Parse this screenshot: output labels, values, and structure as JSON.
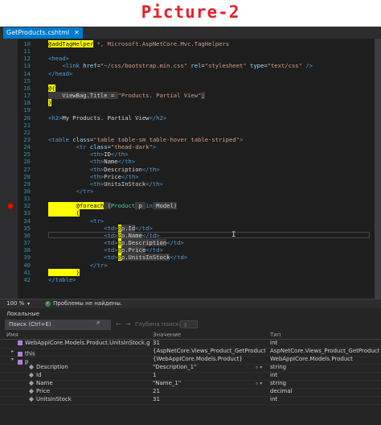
{
  "picture_title": "Picture-2",
  "editor": {
    "tab_label": "GetProducts.cshtml",
    "tab_close": "✕",
    "lines": [
      {
        "n": "10",
        "segments": [
          {
            "t": "@",
            "c": "razor"
          },
          {
            "t": "addTagHelper",
            "c": "razor"
          },
          {
            "t": " *, Microsoft.AspNetCore.Mvc.TagHelpers",
            "c": "str"
          }
        ]
      },
      {
        "n": "11",
        "segments": []
      },
      {
        "n": "12",
        "segments": [
          {
            "t": "<",
            "c": "tag"
          },
          {
            "t": "head",
            "c": "tag"
          },
          {
            "t": ">",
            "c": "tag"
          }
        ]
      },
      {
        "n": "13",
        "segments": [
          {
            "t": "    <",
            "c": "tag"
          },
          {
            "t": "link",
            "c": "tag"
          },
          {
            "t": " href",
            "c": "attr"
          },
          {
            "t": "=",
            "c": "txt"
          },
          {
            "t": "\"~/css/bootstrap.min.css\"",
            "c": "str"
          },
          {
            "t": " rel",
            "c": "attr"
          },
          {
            "t": "=",
            "c": "txt"
          },
          {
            "t": "\"stylesheet\"",
            "c": "str"
          },
          {
            "t": " type",
            "c": "attr"
          },
          {
            "t": "=",
            "c": "txt"
          },
          {
            "t": "\"text/css\"",
            "c": "str"
          },
          {
            "t": " />",
            "c": "tag"
          }
        ]
      },
      {
        "n": "14",
        "segments": [
          {
            "t": "</",
            "c": "tag"
          },
          {
            "t": "head",
            "c": "tag"
          },
          {
            "t": ">",
            "c": "tag"
          }
        ]
      },
      {
        "n": "15",
        "segments": []
      },
      {
        "n": "16",
        "segments": [
          {
            "t": "@{",
            "c": "razor"
          }
        ]
      },
      {
        "n": "17",
        "segments": [
          {
            "t": "    ViewBag.Title = ",
            "c": "rz"
          },
          {
            "t": "\"Products. Partial View\"",
            "c": "str"
          },
          {
            "t": ";",
            "c": "rz"
          }
        ]
      },
      {
        "n": "18",
        "segments": [
          {
            "t": "}",
            "c": "razor"
          }
        ]
      },
      {
        "n": "19",
        "segments": []
      },
      {
        "n": "20",
        "segments": [
          {
            "t": "<",
            "c": "tag"
          },
          {
            "t": "h2",
            "c": "tag"
          },
          {
            "t": ">",
            "c": "tag"
          },
          {
            "t": "My Products. Partial View",
            "c": "txt"
          },
          {
            "t": "</",
            "c": "tag"
          },
          {
            "t": "h2",
            "c": "tag"
          },
          {
            "t": ">",
            "c": "tag"
          }
        ]
      },
      {
        "n": "21",
        "segments": []
      },
      {
        "n": "22",
        "segments": []
      },
      {
        "n": "23",
        "segments": [
          {
            "t": "<",
            "c": "tag"
          },
          {
            "t": "table",
            "c": "tag"
          },
          {
            "t": " class",
            "c": "attr"
          },
          {
            "t": "=",
            "c": "txt"
          },
          {
            "t": "\"table table-sm table-hover table-striped\"",
            "c": "str"
          },
          {
            "t": ">",
            "c": "tag"
          }
        ]
      },
      {
        "n": "24",
        "segments": [
          {
            "t": "        <",
            "c": "tag"
          },
          {
            "t": "tr",
            "c": "tag"
          },
          {
            "t": " class",
            "c": "attr"
          },
          {
            "t": "=",
            "c": "txt"
          },
          {
            "t": "\"thead-dark\"",
            "c": "str"
          },
          {
            "t": ">",
            "c": "tag"
          }
        ]
      },
      {
        "n": "25",
        "segments": [
          {
            "t": "            <",
            "c": "tag"
          },
          {
            "t": "th",
            "c": "tag"
          },
          {
            "t": ">",
            "c": "tag"
          },
          {
            "t": "ID",
            "c": "txt"
          },
          {
            "t": "</",
            "c": "tag"
          },
          {
            "t": "th",
            "c": "tag"
          },
          {
            "t": ">",
            "c": "tag"
          }
        ]
      },
      {
        "n": "26",
        "segments": [
          {
            "t": "            <",
            "c": "tag"
          },
          {
            "t": "th",
            "c": "tag"
          },
          {
            "t": ">",
            "c": "tag"
          },
          {
            "t": "Name",
            "c": "txt"
          },
          {
            "t": "</",
            "c": "tag"
          },
          {
            "t": "th",
            "c": "tag"
          },
          {
            "t": ">",
            "c": "tag"
          }
        ]
      },
      {
        "n": "27",
        "segments": [
          {
            "t": "            <",
            "c": "tag"
          },
          {
            "t": "th",
            "c": "tag"
          },
          {
            "t": ">",
            "c": "tag"
          },
          {
            "t": "Description",
            "c": "txt"
          },
          {
            "t": "</",
            "c": "tag"
          },
          {
            "t": "th",
            "c": "tag"
          },
          {
            "t": ">",
            "c": "tag"
          }
        ]
      },
      {
        "n": "28",
        "segments": [
          {
            "t": "            <",
            "c": "tag"
          },
          {
            "t": "th",
            "c": "tag"
          },
          {
            "t": ">",
            "c": "tag"
          },
          {
            "t": "Price",
            "c": "txt"
          },
          {
            "t": "</",
            "c": "tag"
          },
          {
            "t": "th",
            "c": "tag"
          },
          {
            "t": ">",
            "c": "tag"
          }
        ]
      },
      {
        "n": "29",
        "segments": [
          {
            "t": "            <",
            "c": "tag"
          },
          {
            "t": "th",
            "c": "tag"
          },
          {
            "t": ">",
            "c": "tag"
          },
          {
            "t": "UnitsInStock",
            "c": "txt"
          },
          {
            "t": "</",
            "c": "tag"
          },
          {
            "t": "th",
            "c": "tag"
          },
          {
            "t": ">",
            "c": "tag"
          }
        ]
      },
      {
        "n": "30",
        "segments": [
          {
            "t": "        </",
            "c": "tag"
          },
          {
            "t": "tr",
            "c": "tag"
          },
          {
            "t": ">",
            "c": "tag"
          }
        ]
      },
      {
        "n": "31",
        "segments": []
      },
      {
        "n": "32",
        "segments": [
          {
            "t": "        @",
            "c": "razor"
          },
          {
            "t": "foreach",
            "c": "razor"
          },
          {
            "t": " (",
            "c": "rz"
          },
          {
            "t": "Product",
            "c": "type"
          },
          {
            "t": " p ",
            "c": "rz"
          },
          {
            "t": "in",
            "c": "kw"
          },
          {
            "t": " Model)",
            "c": "rz"
          }
        ]
      },
      {
        "n": "33",
        "segments": [
          {
            "t": "        {",
            "c": "razor"
          }
        ]
      },
      {
        "n": "34",
        "segments": [
          {
            "t": "            <",
            "c": "tag"
          },
          {
            "t": "tr",
            "c": "tag"
          },
          {
            "t": ">",
            "c": "tag"
          }
        ]
      },
      {
        "n": "35",
        "segments": [
          {
            "t": "                <",
            "c": "tag"
          },
          {
            "t": "td",
            "c": "tag"
          },
          {
            "t": ">",
            "c": "tag"
          },
          {
            "t": "@",
            "c": "razor"
          },
          {
            "t": "p.Id",
            "c": "rz"
          },
          {
            "t": "</",
            "c": "tag"
          },
          {
            "t": "td",
            "c": "tag"
          },
          {
            "t": ">",
            "c": "tag"
          }
        ]
      },
      {
        "n": "36",
        "segments": [
          {
            "t": "                <",
            "c": "tag"
          },
          {
            "t": "td",
            "c": "tag"
          },
          {
            "t": ">",
            "c": "tag"
          },
          {
            "t": "@",
            "c": "razor"
          },
          {
            "t": "p.Name",
            "c": "rz"
          },
          {
            "t": "</",
            "c": "tag"
          },
          {
            "t": "td",
            "c": "tag"
          },
          {
            "t": ">",
            "c": "tag"
          }
        ]
      },
      {
        "n": "37",
        "segments": [
          {
            "t": "                <",
            "c": "tag"
          },
          {
            "t": "td",
            "c": "tag"
          },
          {
            "t": ">",
            "c": "tag"
          },
          {
            "t": "@",
            "c": "razor"
          },
          {
            "t": "p.Description",
            "c": "rz"
          },
          {
            "t": "</",
            "c": "tag"
          },
          {
            "t": "td",
            "c": "tag"
          },
          {
            "t": ">",
            "c": "tag"
          }
        ]
      },
      {
        "n": "38",
        "segments": [
          {
            "t": "                <",
            "c": "tag"
          },
          {
            "t": "td",
            "c": "tag"
          },
          {
            "t": ">",
            "c": "tag"
          },
          {
            "t": "@",
            "c": "razor"
          },
          {
            "t": "p.Price",
            "c": "rz"
          },
          {
            "t": "</",
            "c": "tag"
          },
          {
            "t": "td",
            "c": "tag"
          },
          {
            "t": ">",
            "c": "tag"
          }
        ]
      },
      {
        "n": "39",
        "segments": [
          {
            "t": "                <",
            "c": "tag"
          },
          {
            "t": "td",
            "c": "tag"
          },
          {
            "t": ">",
            "c": "tag"
          },
          {
            "t": "@",
            "c": "razor"
          },
          {
            "t": "p.UnitsInStock",
            "c": "rz"
          },
          {
            "t": "</",
            "c": "tag"
          },
          {
            "t": "td",
            "c": "tag"
          },
          {
            "t": ">",
            "c": "tag"
          }
        ]
      },
      {
        "n": "40",
        "segments": [
          {
            "t": "            </",
            "c": "tag"
          },
          {
            "t": "tr",
            "c": "tag"
          },
          {
            "t": ">",
            "c": "tag"
          }
        ]
      },
      {
        "n": "41",
        "segments": [
          {
            "t": "        }",
            "c": "razor"
          }
        ]
      },
      {
        "n": "42",
        "segments": [
          {
            "t": "</",
            "c": "tag"
          },
          {
            "t": "table",
            "c": "tag"
          },
          {
            "t": ">",
            "c": "tag"
          }
        ]
      }
    ],
    "breakpoint_line": "32",
    "current_line": "36"
  },
  "status": {
    "zoom": "100 %",
    "zoom_arrow": "▾",
    "ok_icon": "✓",
    "issues_text": "Проблемы не найдены."
  },
  "locals": {
    "title": "Локальные",
    "search_placeholder": "Поиск (Ctrl+E)",
    "search_icon": "⌕",
    "nav_back": "←",
    "nav_fwd": "→",
    "depth_label": "Глубина поиска:",
    "depth_value": "3",
    "headers": {
      "name": "Имя",
      "value": "Значение",
      "type": "Тип"
    },
    "rows": [
      {
        "indent": 0,
        "expander": "",
        "icon": "obj",
        "name": "WebAppICore.Models.Product.UnitsInStock.get ...",
        "value": "31",
        "type": "int"
      },
      {
        "indent": 0,
        "expander": "▸",
        "icon": "obj",
        "name": "this",
        "value": "{AspNetCore.Views_Product_GetProducts}",
        "type": "AspNetCore.Views_Product_GetProducts"
      },
      {
        "indent": 0,
        "expander": "▾",
        "icon": "obj",
        "name": "p",
        "value": "{WebAppICore.Models.Product}",
        "type": "WebAppICore.Models.Product"
      },
      {
        "indent": 1,
        "expander": "",
        "icon": "prop",
        "name": "Description",
        "value": "\"Description_1\"",
        "type": "string",
        "mag": true
      },
      {
        "indent": 1,
        "expander": "",
        "icon": "prop",
        "name": "Id",
        "value": "1",
        "type": "int"
      },
      {
        "indent": 1,
        "expander": "",
        "icon": "prop",
        "name": "Name",
        "value": "\"Name_1\"",
        "type": "string",
        "mag": true
      },
      {
        "indent": 1,
        "expander": "",
        "icon": "prop",
        "name": "Price",
        "value": "21",
        "type": "decimal"
      },
      {
        "indent": 1,
        "expander": "",
        "icon": "prop",
        "name": "UnitsInStock",
        "value": "31",
        "type": "int"
      }
    ],
    "mag_icon": "⌕ ▾"
  },
  "colors": {
    "accent": "#007acc",
    "breakpoint": "#e51400",
    "title_red": "#e8202a",
    "razor_highlight": "#ffff00"
  }
}
